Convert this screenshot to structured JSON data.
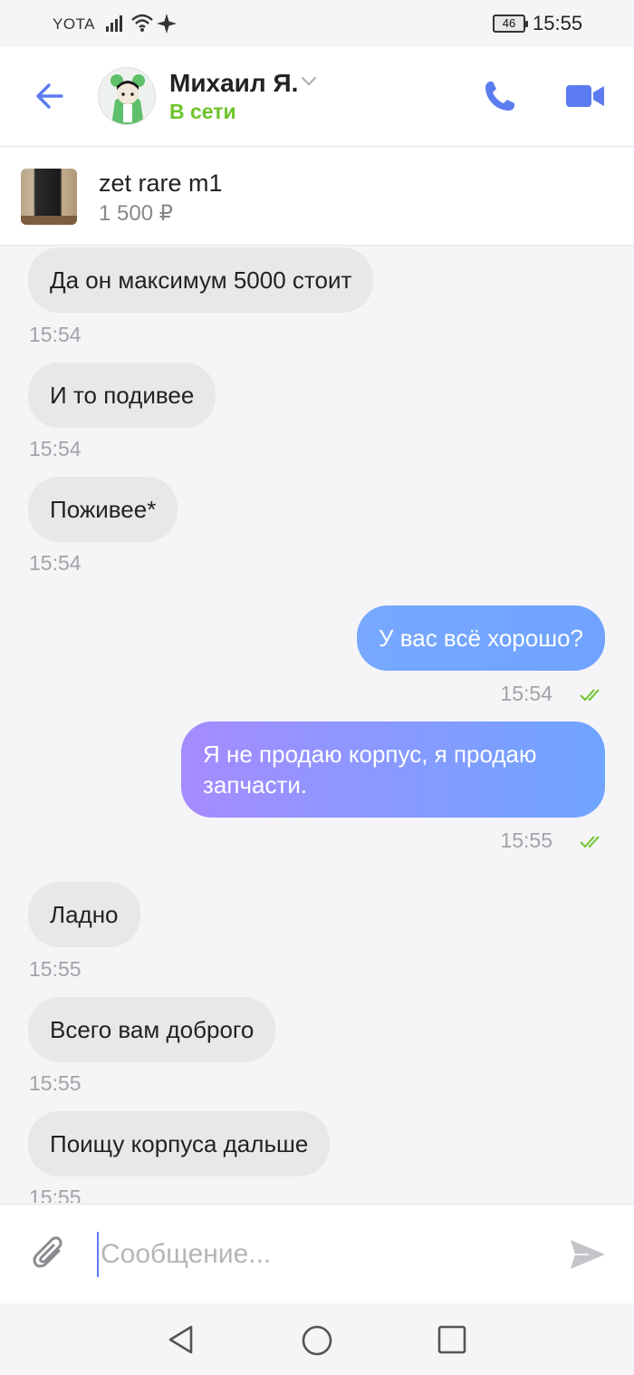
{
  "status_bar": {
    "carrier": "YOTA",
    "battery": "46",
    "time": "15:55"
  },
  "header": {
    "contact_name": "Михаил Я.",
    "contact_status": "В сети",
    "status_color": "#6ec42b",
    "accent_color": "#5b7cf0",
    "icons": [
      "back-arrow-icon",
      "chevron-down-icon",
      "phone-icon",
      "video-camera-icon"
    ]
  },
  "product": {
    "title": "zet rare m1",
    "price": "1 500 ₽"
  },
  "messages": [
    {
      "direction": "in",
      "text": "Да он максимум 5000 стоит",
      "time": "15:54"
    },
    {
      "direction": "in",
      "text": "И то подивее",
      "time": "15:54"
    },
    {
      "direction": "in",
      "text": "Поживее*",
      "time": "15:54"
    },
    {
      "direction": "out",
      "text": "У вас всё хорошо?",
      "time": "15:54",
      "read": true
    },
    {
      "direction": "out",
      "text": "Я не продаю корпус, я продаю запчасти.",
      "time": "15:55",
      "read": true
    },
    {
      "direction": "in",
      "text": "Ладно",
      "time": "15:55"
    },
    {
      "direction": "in",
      "text": "Всего вам доброго",
      "time": "15:55"
    },
    {
      "direction": "in",
      "text": "Поищу корпуса дальше",
      "time": "15:55"
    }
  ],
  "composer": {
    "placeholder": "Сообщение...",
    "value": ""
  },
  "nav": {
    "icons": [
      "nav-back-icon",
      "nav-home-icon",
      "nav-recent-icon"
    ]
  }
}
